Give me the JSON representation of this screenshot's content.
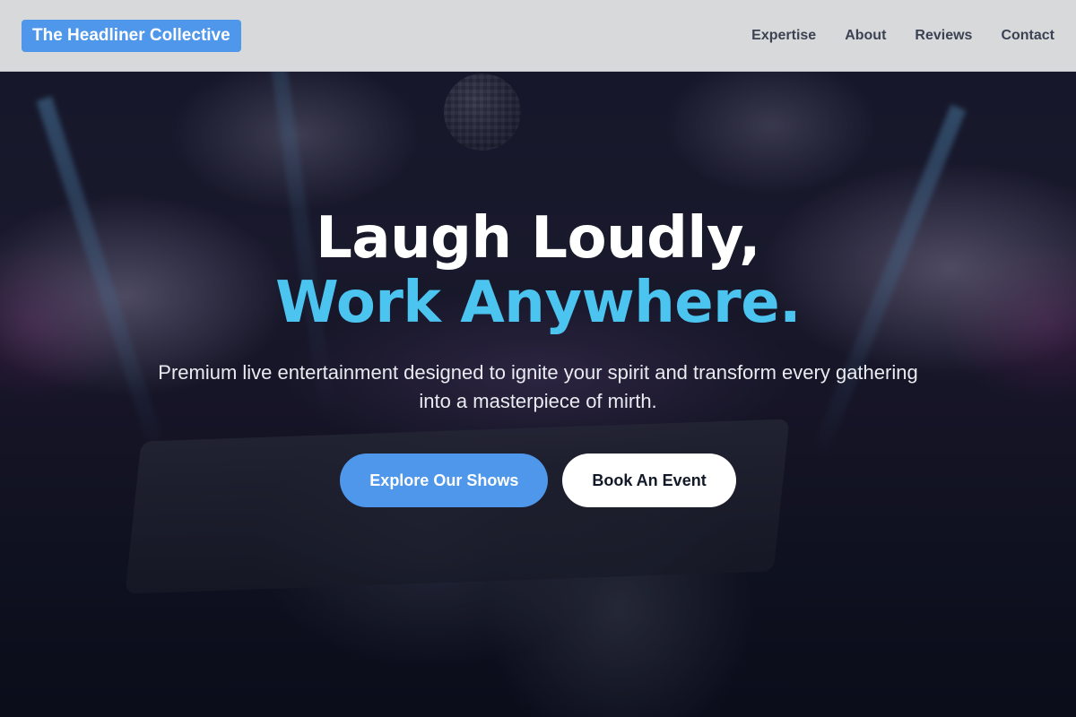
{
  "header": {
    "brand": "The Headliner Collective",
    "nav": [
      {
        "label": "Expertise"
      },
      {
        "label": "About"
      },
      {
        "label": "Reviews"
      },
      {
        "label": "Contact"
      }
    ]
  },
  "hero": {
    "headline_line1": "Laugh Loudly,",
    "headline_line2": "Work Anywhere.",
    "subtitle": "Premium live entertainment designed to ignite your spirit and transform every gathering into a masterpiece of mirth.",
    "primary_cta": "Explore Our Shows",
    "secondary_cta": "Book An Event"
  },
  "colors": {
    "accent": "#4f97ea",
    "headline_highlight": "#4cc4f0",
    "header_bg": "#d8d9db"
  }
}
